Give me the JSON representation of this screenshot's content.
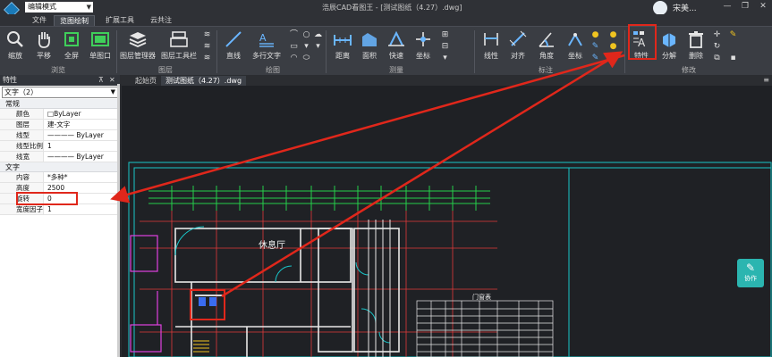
{
  "titlebar": {
    "mode": "编辑模式",
    "title": "浩辰CAD看图王 - [测试图纸（4.27）.dwg]",
    "user": "宋美...",
    "win_min": "—",
    "win_max": "❐",
    "win_close": "✕"
  },
  "menu": {
    "tabs": [
      {
        "label": "文件"
      },
      {
        "label": "览图绘制"
      },
      {
        "label": "扩展工具"
      },
      {
        "label": "云共注"
      }
    ]
  },
  "ribbon": {
    "groups": [
      {
        "label": "浏览"
      },
      {
        "label": "图层"
      },
      {
        "label": "绘图"
      },
      {
        "label": "测量"
      },
      {
        "label": "标注"
      },
      {
        "label": "修改"
      }
    ],
    "buttons": [
      {
        "label": "缩放",
        "icon": "zoom-icon"
      },
      {
        "label": "平移",
        "icon": "pan-hand-icon"
      },
      {
        "label": "全屏",
        "icon": "fullscreen-icon"
      },
      {
        "label": "单图口",
        "icon": "single-window-icon"
      },
      {
        "label": "图层管理器",
        "icon": "layers-icon"
      },
      {
        "label": "图层工具栏",
        "icon": "layer-toolbar-icon"
      },
      {
        "label": "直线",
        "icon": "line-icon"
      },
      {
        "label": "多行文字",
        "icon": "mtext-icon"
      },
      {
        "label": "距离",
        "icon": "distance-icon"
      },
      {
        "label": "面积",
        "icon": "area-icon"
      },
      {
        "label": "快速",
        "icon": "quick-measure-icon"
      },
      {
        "label": "坐标",
        "icon": "coordinate-icon"
      },
      {
        "label": "线性",
        "icon": "linear-dim-icon"
      },
      {
        "label": "对齐",
        "icon": "aligned-dim-icon"
      },
      {
        "label": "角度",
        "icon": "angle-dim-icon"
      },
      {
        "label": "坐标",
        "icon": "coordinate-dim-icon"
      },
      {
        "label": "特性",
        "icon": "properties-icon"
      },
      {
        "label": "分解",
        "icon": "explode-icon"
      },
      {
        "label": "删除",
        "icon": "delete-icon"
      }
    ]
  },
  "panel": {
    "title": "特性",
    "pin": "⊼",
    "close": "✕",
    "object_type": "文字（2）",
    "sections": {
      "general": "常规",
      "text": "文字"
    },
    "general_rows": [
      {
        "key": "颜色",
        "value": "□ByLayer"
      },
      {
        "key": "图层",
        "value": "建-文字"
      },
      {
        "key": "线型",
        "value": "———— ByLayer"
      },
      {
        "key": "线型比例",
        "value": "1"
      },
      {
        "key": "线宽",
        "value": "———— ByLayer"
      }
    ],
    "text_rows": [
      {
        "key": "内容",
        "value": "*多种*"
      },
      {
        "key": "高度",
        "value": "2500"
      },
      {
        "key": "旋转",
        "value": "0"
      },
      {
        "key": "宽度因子",
        "value": "1"
      }
    ]
  },
  "doctabs": {
    "tabs": [
      {
        "label": "起始页"
      },
      {
        "label": "测试图纸（4.27）.dwg"
      }
    ],
    "menu": "≡"
  },
  "canvas": {
    "room_label": "休息厅",
    "table_title": "门窗表",
    "collab_label": "协作",
    "collab_icon": "✎"
  },
  "colors": {
    "highlight": "#e0271b",
    "cad_cyan": "#19c6c9",
    "cad_green": "#26d04a",
    "cad_red": "#e23a3a",
    "collab": "#2bb5b0"
  }
}
